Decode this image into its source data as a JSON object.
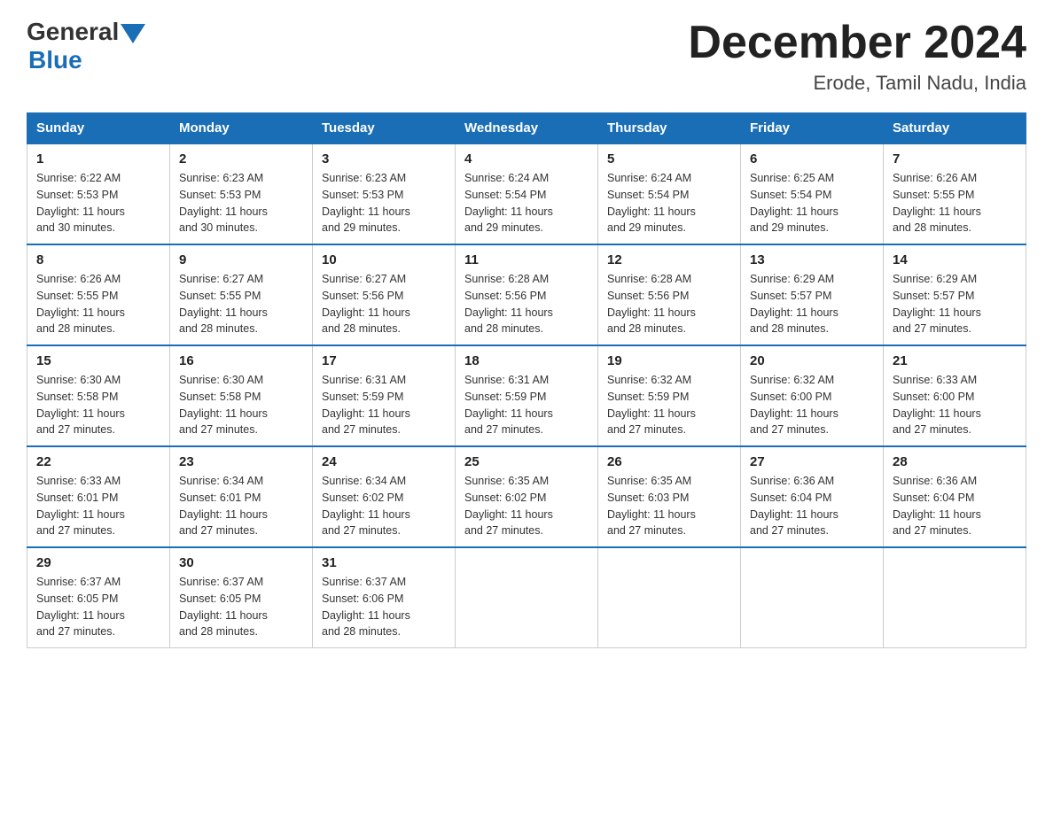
{
  "logo": {
    "text_general": "General",
    "text_blue": "Blue"
  },
  "title": {
    "month_year": "December 2024",
    "location": "Erode, Tamil Nadu, India"
  },
  "headers": [
    "Sunday",
    "Monday",
    "Tuesday",
    "Wednesday",
    "Thursday",
    "Friday",
    "Saturday"
  ],
  "weeks": [
    [
      {
        "day": "1",
        "sunrise": "6:22 AM",
        "sunset": "5:53 PM",
        "daylight": "11 hours and 30 minutes."
      },
      {
        "day": "2",
        "sunrise": "6:23 AM",
        "sunset": "5:53 PM",
        "daylight": "11 hours and 30 minutes."
      },
      {
        "day": "3",
        "sunrise": "6:23 AM",
        "sunset": "5:53 PM",
        "daylight": "11 hours and 29 minutes."
      },
      {
        "day": "4",
        "sunrise": "6:24 AM",
        "sunset": "5:54 PM",
        "daylight": "11 hours and 29 minutes."
      },
      {
        "day": "5",
        "sunrise": "6:24 AM",
        "sunset": "5:54 PM",
        "daylight": "11 hours and 29 minutes."
      },
      {
        "day": "6",
        "sunrise": "6:25 AM",
        "sunset": "5:54 PM",
        "daylight": "11 hours and 29 minutes."
      },
      {
        "day": "7",
        "sunrise": "6:26 AM",
        "sunset": "5:55 PM",
        "daylight": "11 hours and 28 minutes."
      }
    ],
    [
      {
        "day": "8",
        "sunrise": "6:26 AM",
        "sunset": "5:55 PM",
        "daylight": "11 hours and 28 minutes."
      },
      {
        "day": "9",
        "sunrise": "6:27 AM",
        "sunset": "5:55 PM",
        "daylight": "11 hours and 28 minutes."
      },
      {
        "day": "10",
        "sunrise": "6:27 AM",
        "sunset": "5:56 PM",
        "daylight": "11 hours and 28 minutes."
      },
      {
        "day": "11",
        "sunrise": "6:28 AM",
        "sunset": "5:56 PM",
        "daylight": "11 hours and 28 minutes."
      },
      {
        "day": "12",
        "sunrise": "6:28 AM",
        "sunset": "5:56 PM",
        "daylight": "11 hours and 28 minutes."
      },
      {
        "day": "13",
        "sunrise": "6:29 AM",
        "sunset": "5:57 PM",
        "daylight": "11 hours and 28 minutes."
      },
      {
        "day": "14",
        "sunrise": "6:29 AM",
        "sunset": "5:57 PM",
        "daylight": "11 hours and 27 minutes."
      }
    ],
    [
      {
        "day": "15",
        "sunrise": "6:30 AM",
        "sunset": "5:58 PM",
        "daylight": "11 hours and 27 minutes."
      },
      {
        "day": "16",
        "sunrise": "6:30 AM",
        "sunset": "5:58 PM",
        "daylight": "11 hours and 27 minutes."
      },
      {
        "day": "17",
        "sunrise": "6:31 AM",
        "sunset": "5:59 PM",
        "daylight": "11 hours and 27 minutes."
      },
      {
        "day": "18",
        "sunrise": "6:31 AM",
        "sunset": "5:59 PM",
        "daylight": "11 hours and 27 minutes."
      },
      {
        "day": "19",
        "sunrise": "6:32 AM",
        "sunset": "5:59 PM",
        "daylight": "11 hours and 27 minutes."
      },
      {
        "day": "20",
        "sunrise": "6:32 AM",
        "sunset": "6:00 PM",
        "daylight": "11 hours and 27 minutes."
      },
      {
        "day": "21",
        "sunrise": "6:33 AM",
        "sunset": "6:00 PM",
        "daylight": "11 hours and 27 minutes."
      }
    ],
    [
      {
        "day": "22",
        "sunrise": "6:33 AM",
        "sunset": "6:01 PM",
        "daylight": "11 hours and 27 minutes."
      },
      {
        "day": "23",
        "sunrise": "6:34 AM",
        "sunset": "6:01 PM",
        "daylight": "11 hours and 27 minutes."
      },
      {
        "day": "24",
        "sunrise": "6:34 AM",
        "sunset": "6:02 PM",
        "daylight": "11 hours and 27 minutes."
      },
      {
        "day": "25",
        "sunrise": "6:35 AM",
        "sunset": "6:02 PM",
        "daylight": "11 hours and 27 minutes."
      },
      {
        "day": "26",
        "sunrise": "6:35 AM",
        "sunset": "6:03 PM",
        "daylight": "11 hours and 27 minutes."
      },
      {
        "day": "27",
        "sunrise": "6:36 AM",
        "sunset": "6:04 PM",
        "daylight": "11 hours and 27 minutes."
      },
      {
        "day": "28",
        "sunrise": "6:36 AM",
        "sunset": "6:04 PM",
        "daylight": "11 hours and 27 minutes."
      }
    ],
    [
      {
        "day": "29",
        "sunrise": "6:37 AM",
        "sunset": "6:05 PM",
        "daylight": "11 hours and 27 minutes."
      },
      {
        "day": "30",
        "sunrise": "6:37 AM",
        "sunset": "6:05 PM",
        "daylight": "11 hours and 28 minutes."
      },
      {
        "day": "31",
        "sunrise": "6:37 AM",
        "sunset": "6:06 PM",
        "daylight": "11 hours and 28 minutes."
      },
      null,
      null,
      null,
      null
    ]
  ],
  "labels": {
    "sunrise": "Sunrise:",
    "sunset": "Sunset:",
    "daylight": "Daylight:"
  }
}
